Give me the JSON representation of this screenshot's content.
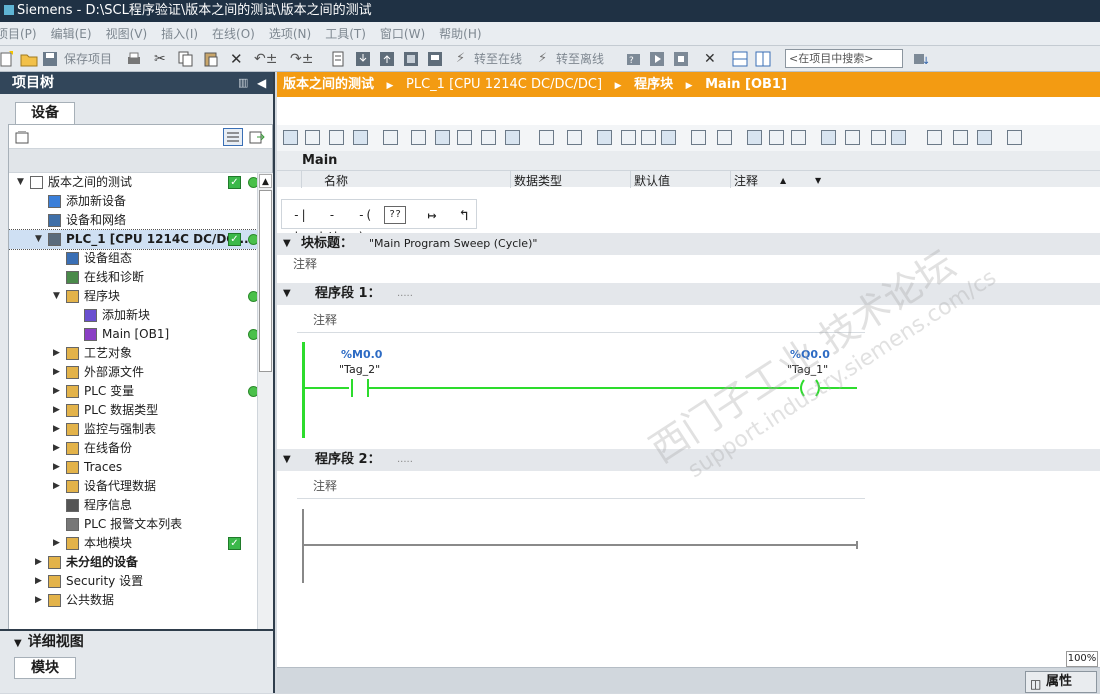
{
  "window": {
    "title": "Siemens  -  D:\\SCL程序验证\\版本之间的测试\\版本之间的测试"
  },
  "menu": [
    "项目(P)",
    "编辑(E)",
    "视图(V)",
    "插入(I)",
    "在线(O)",
    "选项(N)",
    "工具(T)",
    "窗口(W)",
    "帮助(H)"
  ],
  "toolbar": {
    "save_project": "保存项目",
    "go_online": "转至在线",
    "go_offline": "转至离线",
    "search_placeholder": "<在项目中搜索>"
  },
  "left": {
    "title": "项目树",
    "tab": "设备",
    "tree": [
      {
        "label": "版本之间的测试",
        "level": 0,
        "arrow": "▼",
        "icon": "project-icon",
        "ok": true,
        "dot": true
      },
      {
        "label": "添加新设备",
        "level": 1,
        "arrow": "",
        "icon": "add-device-icon"
      },
      {
        "label": "设备和网络",
        "level": 1,
        "arrow": "",
        "icon": "network-icon"
      },
      {
        "label": "PLC_1 [CPU 1214C DC/DC/...",
        "level": 1,
        "arrow": "▼",
        "icon": "plc-icon",
        "ok": true,
        "dot": true,
        "selected": true
      },
      {
        "label": "设备组态",
        "level": 2,
        "arrow": "",
        "icon": "device-config-icon"
      },
      {
        "label": "在线和诊断",
        "level": 2,
        "arrow": "",
        "icon": "diagnostics-icon"
      },
      {
        "label": "程序块",
        "level": 2,
        "arrow": "▼",
        "icon": "folder-icon",
        "dot": true
      },
      {
        "label": "添加新块",
        "level": 3,
        "arrow": "",
        "icon": "add-block-icon"
      },
      {
        "label": "Main [OB1]",
        "level": 3,
        "arrow": "",
        "icon": "ob-icon",
        "dot": true
      },
      {
        "label": "工艺对象",
        "level": 2,
        "arrow": "▶",
        "icon": "folder-icon"
      },
      {
        "label": "外部源文件",
        "level": 2,
        "arrow": "▶",
        "icon": "folder-icon"
      },
      {
        "label": "PLC 变量",
        "level": 2,
        "arrow": "▶",
        "icon": "folder-icon",
        "dot": true
      },
      {
        "label": "PLC 数据类型",
        "level": 2,
        "arrow": "▶",
        "icon": "folder-icon"
      },
      {
        "label": "监控与强制表",
        "level": 2,
        "arrow": "▶",
        "icon": "folder-icon"
      },
      {
        "label": "在线备份",
        "level": 2,
        "arrow": "▶",
        "icon": "folder-icon"
      },
      {
        "label": "Traces",
        "level": 2,
        "arrow": "▶",
        "icon": "folder-icon"
      },
      {
        "label": "设备代理数据",
        "level": 2,
        "arrow": "▶",
        "icon": "folder-icon"
      },
      {
        "label": "程序信息",
        "level": 2,
        "arrow": "",
        "icon": "info-icon"
      },
      {
        "label": "PLC 报警文本列表",
        "level": 2,
        "arrow": "",
        "icon": "list-icon"
      },
      {
        "label": "本地模块",
        "level": 2,
        "arrow": "▶",
        "icon": "folder-icon",
        "ok": true
      },
      {
        "label": "未分组的设备",
        "level": 1,
        "arrow": "▶",
        "icon": "folder-icon",
        "bold": true
      },
      {
        "label": "Security 设置",
        "level": 1,
        "arrow": "▶",
        "icon": "folder-icon"
      },
      {
        "label": "公共数据",
        "level": 1,
        "arrow": "▶",
        "icon": "folder-icon"
      }
    ],
    "detail_title": "详细视图",
    "detail_tab": "模块"
  },
  "breadcrumb": [
    "版本之间的测试",
    "PLC_1 [CPU 1214C DC/DC/DC]",
    "程序块",
    "Main [OB1]"
  ],
  "editor": {
    "block_name": "Main",
    "columns": [
      "名称",
      "数据类型",
      "默认值",
      "注释"
    ],
    "ladder_symbols": [
      "-| |-",
      "-|/|-",
      "-( )-",
      "??",
      "↦",
      "↰"
    ],
    "block_title_label": "块标题：",
    "block_title": "\"Main Program Sweep (Cycle)\"",
    "block_comment": "注释",
    "networks": [
      {
        "label": "程序段 1：",
        "dots": ".....",
        "comment": "注释",
        "contact_addr": "%M0.0",
        "contact_tag": "\"Tag_2\"",
        "coil_addr": "%Q0.0",
        "coil_tag": "\"Tag_1\""
      },
      {
        "label": "程序段 2：",
        "dots": ".....",
        "comment": "注释"
      }
    ]
  },
  "status": {
    "zoom": "100%",
    "properties": "属性"
  },
  "watermark": {
    "line1": "西门子工业  技术论坛",
    "line2": "support.industry.siemens.com/cs"
  }
}
